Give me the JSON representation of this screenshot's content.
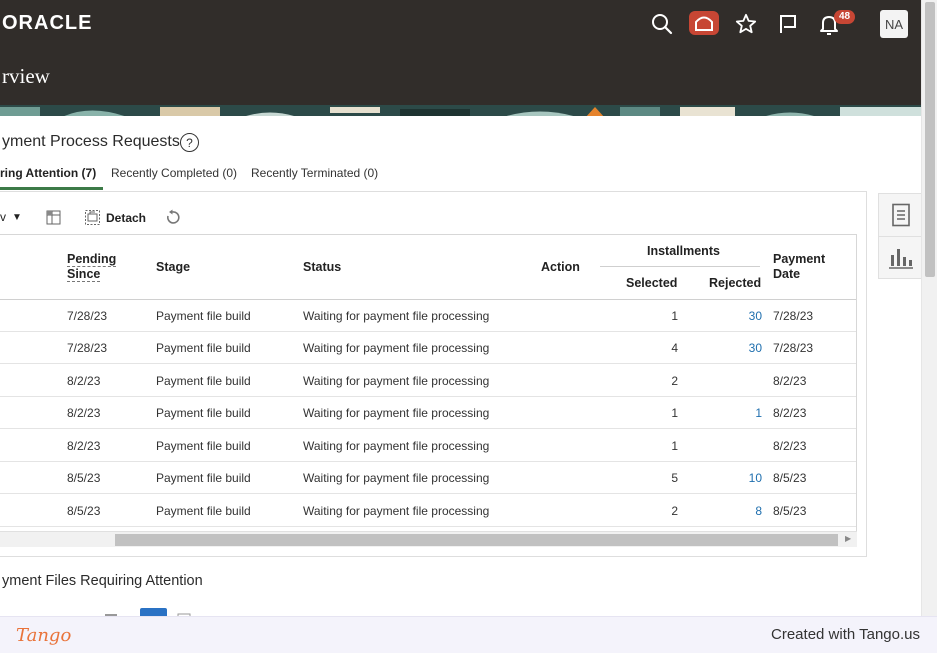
{
  "header": {
    "logo": "ORACLE",
    "page_title": "rview",
    "notification_count": "48",
    "avatar_initials": "NA"
  },
  "section": {
    "title": "yment Process Requests",
    "help": "?"
  },
  "tabs": [
    {
      "label": "ring Attention (7)",
      "active": true
    },
    {
      "label": "Recently Completed (0)",
      "active": false
    },
    {
      "label": "Recently Terminated (0)",
      "active": false
    }
  ],
  "toolbar": {
    "view_label": "v",
    "detach_label": "Detach"
  },
  "table": {
    "headers": {
      "pending_since_1": "Pending",
      "pending_since_2": "Since",
      "stage": "Stage",
      "status": "Status",
      "action": "Action",
      "installments": "Installments",
      "selected": "Selected",
      "rejected": "Rejected",
      "payment_date_1": "Payment",
      "payment_date_2": "Date"
    },
    "rows": [
      {
        "pending": "7/28/23",
        "stage": "Payment file build",
        "status": "Waiting for payment file processing",
        "selected": "1",
        "rejected": "30",
        "date": "7/28/23"
      },
      {
        "pending": "7/28/23",
        "stage": "Payment file build",
        "status": "Waiting for payment file processing",
        "selected": "4",
        "rejected": "30",
        "date": "7/28/23"
      },
      {
        "pending": "8/2/23",
        "stage": "Payment file build",
        "status": "Waiting for payment file processing",
        "selected": "2",
        "rejected": "",
        "date": "8/2/23"
      },
      {
        "pending": "8/2/23",
        "stage": "Payment file build",
        "status": "Waiting for payment file processing",
        "selected": "1",
        "rejected": "1",
        "date": "8/2/23"
      },
      {
        "pending": "8/2/23",
        "stage": "Payment file build",
        "status": "Waiting for payment file processing",
        "selected": "1",
        "rejected": "",
        "date": "8/2/23"
      },
      {
        "pending": "8/5/23",
        "stage": "Payment file build",
        "status": "Waiting for payment file processing",
        "selected": "5",
        "rejected": "10",
        "date": "8/5/23"
      },
      {
        "pending": "8/5/23",
        "stage": "Payment file build",
        "status": "Waiting for payment file processing",
        "selected": "2",
        "rejected": "8",
        "date": "8/5/23"
      }
    ]
  },
  "section2": {
    "title": "yment Files Requiring Attention"
  },
  "footer": {
    "logo": "Tango",
    "credit": "Created with Tango.us"
  },
  "colors": {
    "header_bg": "#312d2a",
    "accent_red": "#c74634",
    "tab_green": "#3c7a47",
    "link_blue": "#1f6fae"
  },
  "icons": [
    "search-icon",
    "home-icon",
    "star-icon",
    "flag-icon",
    "bell-icon",
    "help-icon",
    "freeze-columns-icon",
    "detach-icon",
    "refresh-icon",
    "document-icon",
    "bar-chart-icon"
  ]
}
